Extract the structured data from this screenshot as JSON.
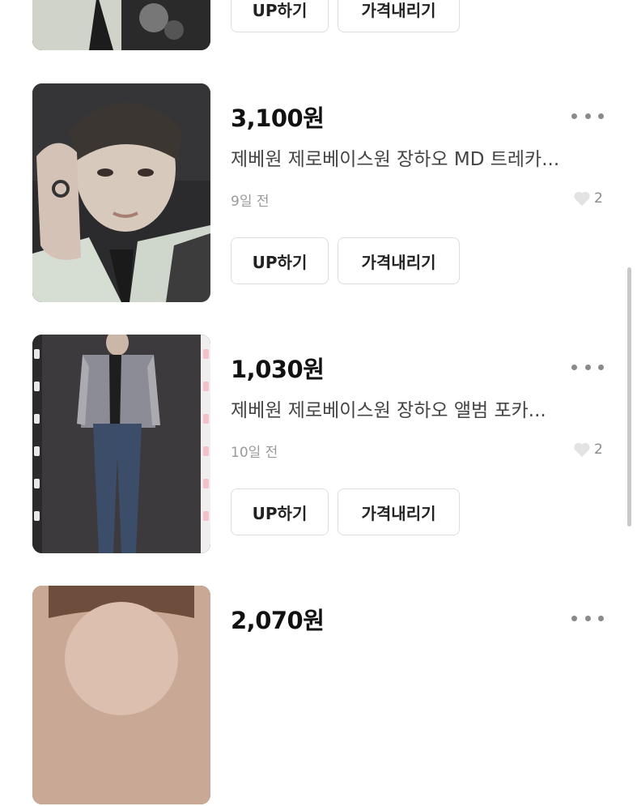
{
  "listings": [
    {
      "price": "",
      "title": "",
      "time": "",
      "likes": "",
      "up_label": "UP하기",
      "price_down_label": "가격내리기"
    },
    {
      "price": "3,100원",
      "title": "제베원 제로베이스원 장하오 MD 트레카...",
      "time": "9일 전",
      "likes": "2",
      "up_label": "UP하기",
      "price_down_label": "가격내리기"
    },
    {
      "price": "1,030원",
      "title": "제베원 제로베이스원 장하오 앨범 포카...",
      "time": "10일 전",
      "likes": "2",
      "up_label": "UP하기",
      "price_down_label": "가격내리기"
    },
    {
      "price": "2,070원",
      "title": "",
      "time": "",
      "likes": "",
      "up_label": "",
      "price_down_label": ""
    }
  ],
  "icons": {
    "more": "more-dots-icon",
    "like": "heart-icon"
  },
  "colors": {
    "text_primary": "#111111",
    "text_secondary": "#444444",
    "text_muted": "#9a9a9a",
    "border": "#dddddd"
  }
}
